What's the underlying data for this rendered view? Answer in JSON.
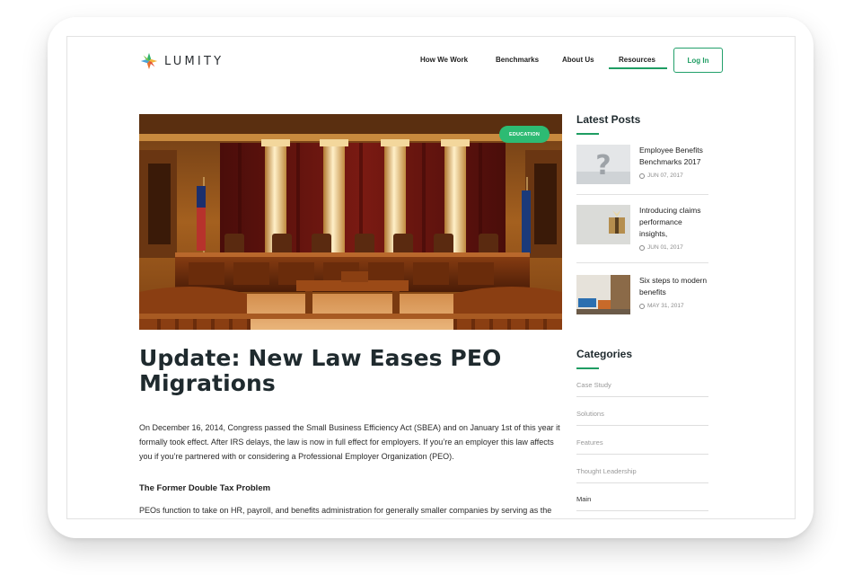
{
  "brand": {
    "name": "LUMITY"
  },
  "nav": {
    "items": [
      {
        "label": "How We Work",
        "active": false
      },
      {
        "label": "Benchmarks",
        "active": false
      },
      {
        "label": "About Us",
        "active": false
      },
      {
        "label": "Resources",
        "active": true
      }
    ],
    "login_label": "Log In"
  },
  "article": {
    "tag": "EDUCATION",
    "title": "Update: New Law Eases PEO Migrations",
    "intro": "On December 16, 2014, Congress passed the Small Business Efficiency Act (SBEA) and on January 1st of this year it formally took effect. After IRS delays, the law is now in full effect for employers. If you’re an employer this law affects you if you’re partnered with or considering a Professional Employer Organization (PEO).",
    "subheading": "The Former Double Tax Problem",
    "body": "PEOs function to take on HR, payroll, and benefits administration for generally smaller companies by serving as the"
  },
  "sidebar": {
    "latest_heading": "Latest Posts",
    "posts": [
      {
        "title": "Employee Benefits Benchmarks 2017",
        "date": "JUN 07, 2017"
      },
      {
        "title": "Introducing claims performance insights,",
        "date": "JUN 01, 2017"
      },
      {
        "title": "Six steps to modern benefits",
        "date": "MAY 31, 2017"
      }
    ],
    "categories_heading": "Categories",
    "categories": [
      "Case Study",
      "Solutions",
      "Features",
      "Thought Leadership",
      "Main"
    ]
  },
  "colors": {
    "accent": "#1f9d63",
    "tag_bg": "#2dbb73",
    "text_dark": "#1f2a2e"
  },
  "icons": [
    "lumity-logo-icon",
    "clock-icon"
  ]
}
